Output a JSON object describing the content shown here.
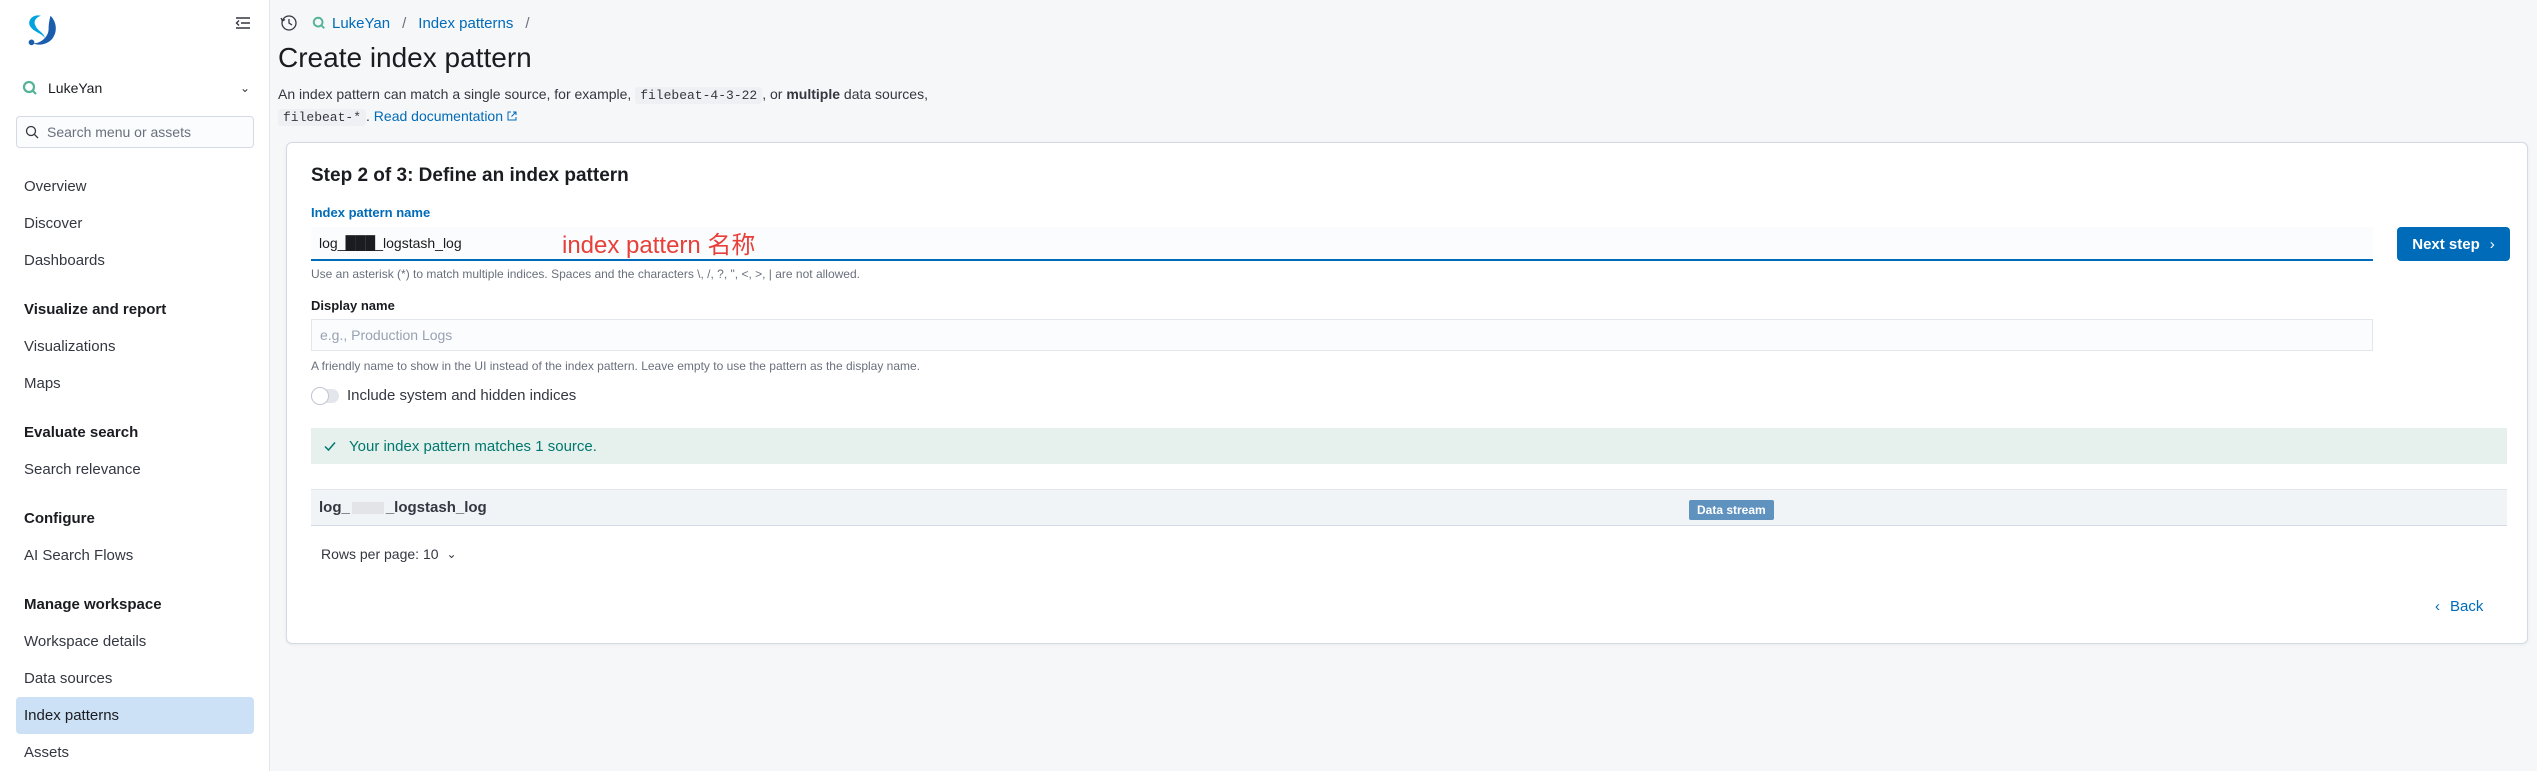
{
  "sidebar": {
    "workspace_name": "LukeYan",
    "search_placeholder": "Search menu or assets",
    "items": [
      {
        "label": "Overview"
      },
      {
        "label": "Discover"
      },
      {
        "label": "Dashboards"
      }
    ],
    "sections": [
      {
        "heading": "Visualize and report",
        "items": [
          "Visualizations",
          "Maps"
        ]
      },
      {
        "heading": "Evaluate search",
        "items": [
          "Search relevance"
        ]
      },
      {
        "heading": "Configure",
        "items": [
          "AI Search Flows"
        ]
      },
      {
        "heading": "Manage workspace",
        "items": [
          "Workspace details",
          "Data sources",
          "Index patterns",
          "Assets"
        ]
      }
    ],
    "active_item": "Index patterns"
  },
  "breadcrumbs": {
    "workspace": "LukeYan",
    "page": "Index patterns",
    "trailing_sep": "/"
  },
  "page": {
    "title": "Create index pattern",
    "desc_prefix": "An index pattern can match a single source, for example,",
    "desc_code1": "filebeat-4-3-22",
    "desc_mid": ", or",
    "desc_bold": "multiple",
    "desc_suffix": "data sources,",
    "desc_code2": "filebeat-*",
    "desc_period": ".",
    "doc_link": "Read documentation"
  },
  "step": {
    "title": "Step 2 of 3: Define an index pattern",
    "name_label": "Index pattern name",
    "name_value": "log_███_logstash_log",
    "annotation": "index pattern 名称",
    "name_help": "Use an asterisk (*) to match multiple indices. Spaces and the characters \\, /, ?, \", <, >, | are not allowed.",
    "next_button": "Next step",
    "display_label": "Display name",
    "display_placeholder": "e.g., Production Logs",
    "display_help": "A friendly name to show in the UI instead of the index pattern. Leave empty to use the pattern as the display name.",
    "toggle_label": "Include system and hidden indices",
    "callout": "Your index pattern matches 1 source.",
    "row_name_prefix": "log_",
    "row_name_suffix": "_logstash_log",
    "row_badge": "Data stream",
    "rows_per_page": "Rows per page: 10",
    "back": "Back"
  },
  "colors": {
    "primary": "#006bb8",
    "success_bg": "#e6f1ee",
    "success_text": "#01776d",
    "annotation": "#e7403a",
    "badge": "#6092c0",
    "active_nav": "#cce1f5"
  }
}
